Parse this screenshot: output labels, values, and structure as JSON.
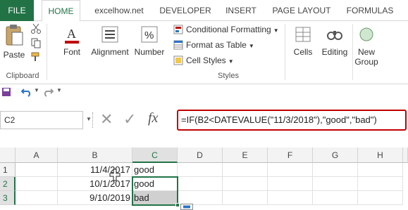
{
  "tabs": [
    "FILE",
    "HOME",
    "excelhow.net",
    "DEVELOPER",
    "INSERT",
    "PAGE LAYOUT",
    "FORMULAS"
  ],
  "ribbon": {
    "paste_label": "Paste",
    "clipboard_label": "Clipboard",
    "font_label": "Font",
    "alignment_label": "Alignment",
    "number_label": "Number",
    "number_icon_text": "%",
    "conditional_formatting": "Conditional Formatting",
    "format_as_table": "Format as Table",
    "cell_styles": "Cell Styles",
    "styles_label": "Styles",
    "cells_label": "Cells",
    "editing_label": "Editing",
    "new_group_label_1": "New",
    "new_group_label_2": "Group"
  },
  "formula_bar": {
    "name_box": "C2",
    "formula": "=IF(B2<DATEVALUE(\"11/3/2018\"),\"good\",\"bad\")",
    "fx_label": "fx"
  },
  "grid": {
    "columns": [
      "A",
      "B",
      "C",
      "D",
      "E",
      "F",
      "G",
      "H"
    ],
    "rows": [
      {
        "row": "1",
        "b": "11/4/2017",
        "c": "good"
      },
      {
        "row": "2",
        "b": "10/1/2017",
        "c": "good"
      },
      {
        "row": "3",
        "b": "9/10/2019",
        "c": "bad"
      }
    ]
  },
  "colors": {
    "accent": "#217346",
    "highlight": "#c00000",
    "selected_cell": "#d0d0d0"
  }
}
